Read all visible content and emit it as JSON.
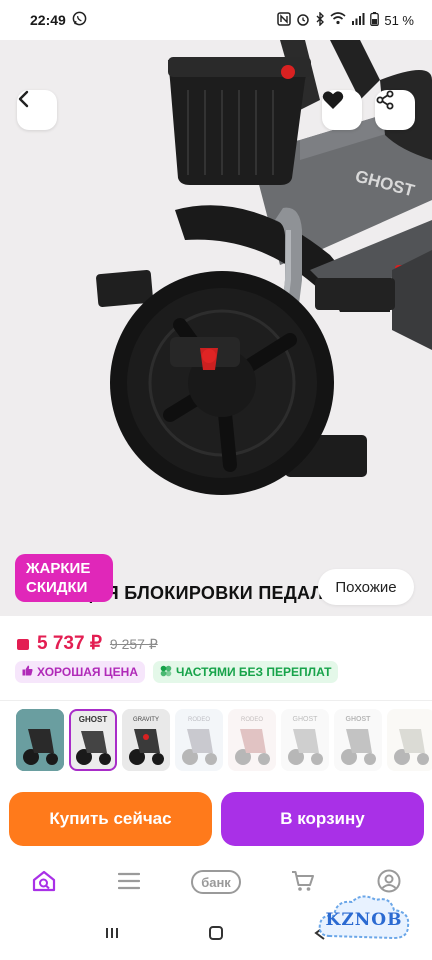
{
  "status_bar": {
    "time": "22:49",
    "battery": "51 %",
    "icons": [
      "whatsapp-icon",
      "nfc-icon",
      "alarm-icon",
      "bluetooth-icon",
      "wifi-icon",
      "signal-icon",
      "battery-icon"
    ]
  },
  "product": {
    "brand_on_frame": "GHOST",
    "caption": "ФУНКЦИЯ БЛОКИРОВКИ ПЕДАЛЕЙ",
    "promo_line1": "ЖАРКИЕ",
    "promo_line2": "СКИДКИ",
    "similar_label": "Похожие"
  },
  "price": {
    "current": "5 737 ₽",
    "old": "9 257 ₽",
    "chip_good": "ХОРОШАЯ ЦЕНА",
    "chip_parts": "ЧАСТЯМИ БЕЗ ПЕРЕПЛАТ"
  },
  "thumbnails": [
    {
      "label": "",
      "brand": ""
    },
    {
      "label": "GHOST",
      "brand": "GHOST"
    },
    {
      "label": "GRAVITY",
      "brand": ""
    },
    {
      "label": "RODEO",
      "brand": ""
    },
    {
      "label": "RODEO",
      "brand": ""
    },
    {
      "label": "GHOST",
      "brand": ""
    },
    {
      "label": "GHOST",
      "brand": ""
    },
    {
      "label": "",
      "brand": ""
    }
  ],
  "actions": {
    "buy_now": "Купить сейчас",
    "add_to_cart": "В корзину"
  },
  "bottom_nav": {
    "bank_label": "банк",
    "icons": [
      "search-home-icon",
      "menu-icon",
      "bank-icon",
      "cart-icon",
      "profile-icon"
    ]
  },
  "watermark": "KZNOB",
  "colors": {
    "accent_purple": "#a930e7",
    "accent_orange": "#ff7a1b",
    "price_red": "#e31e52",
    "promo_pink": "#e027b9",
    "good_green": "#17a34a"
  }
}
